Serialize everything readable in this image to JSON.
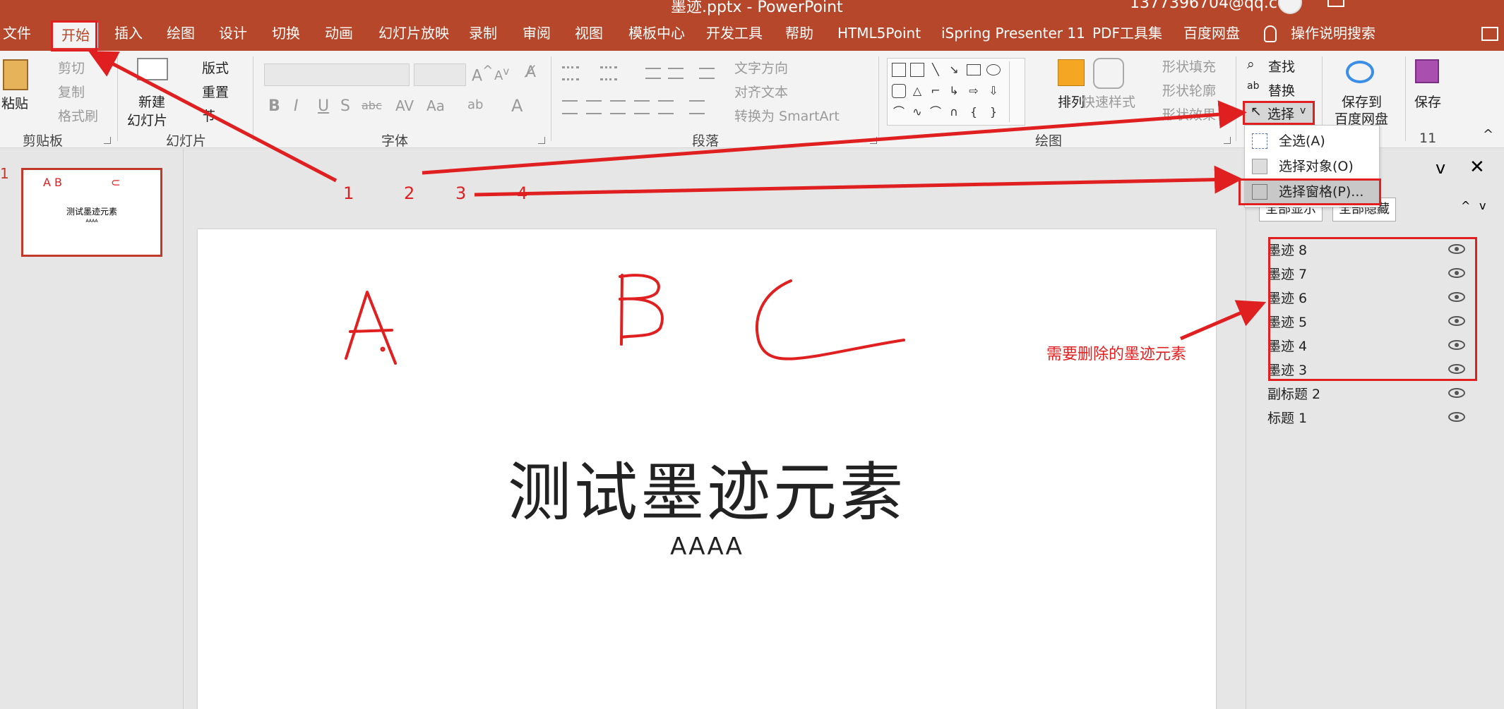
{
  "window": {
    "doc_title": "墨迹.pptx  -  PowerPoint",
    "account": "1377396704@qq.com"
  },
  "tabs": [
    "文件",
    "开始",
    "插入",
    "绘图",
    "设计",
    "切换",
    "动画",
    "幻灯片放映",
    "录制",
    "审阅",
    "视图",
    "模板中心",
    "开发工具",
    "帮助",
    "HTML5Point",
    "iSpring Presenter 11",
    "PDF工具集",
    "百度网盘",
    "操作说明搜索"
  ],
  "ribbon": {
    "clipboard": {
      "paste": "粘贴",
      "cut": "剪切",
      "copy": "复制",
      "format_painter": "格式刷",
      "label": "剪贴板"
    },
    "slides": {
      "new_slide_1": "新建",
      "new_slide_2": "幻灯片",
      "layout": "版式",
      "reset": "重置",
      "section": "节",
      "label": "幻灯片"
    },
    "font": {
      "label": "字体",
      "bold": "B",
      "italic": "I",
      "underline": "U",
      "shadow": "S",
      "strike": "abc",
      "case": "Aa"
    },
    "paragraph": {
      "text_direction": "文字方向",
      "align_text": "对齐文本",
      "smartart": "转换为 SmartArt",
      "label": "段落"
    },
    "drawing": {
      "arrange": "排列",
      "quick_styles": "快速样式",
      "fill": "形状填充",
      "outline": "形状轮廓",
      "effects": "形状效果",
      "label": "绘图"
    },
    "editing": {
      "find": "查找",
      "replace": "替换",
      "select": "选择"
    },
    "baidu": {
      "save_to_1": "保存到",
      "save_to_2": "百度网盘"
    },
    "save": {
      "save": "保存",
      "group_num": "11"
    }
  },
  "select_menu": {
    "items": [
      "全选(A)",
      "选择对象(O)",
      "选择窗格(P)..."
    ]
  },
  "selection_pane": {
    "show_all": "全部显示",
    "hide_all": "全部隐藏",
    "layers": [
      "墨迹 8",
      "墨迹 7",
      "墨迹 6",
      "墨迹 5",
      "墨迹 4",
      "墨迹 3",
      "副标题 2",
      "标题 1"
    ]
  },
  "thumbnail": {
    "slide_number": "1",
    "abc": "A      B",
    "title": "测试墨迹元素",
    "subtitle": "AAAA"
  },
  "slide": {
    "title": "测试墨迹元素",
    "subtitle": "AAAA"
  },
  "annotations": {
    "steps": [
      "1",
      "2",
      "3",
      "4"
    ],
    "ink_note": "需要删除的墨迹元素",
    "color": "#e02020"
  },
  "colors": {
    "accent": "#b7472a",
    "ink": "#e02020"
  }
}
